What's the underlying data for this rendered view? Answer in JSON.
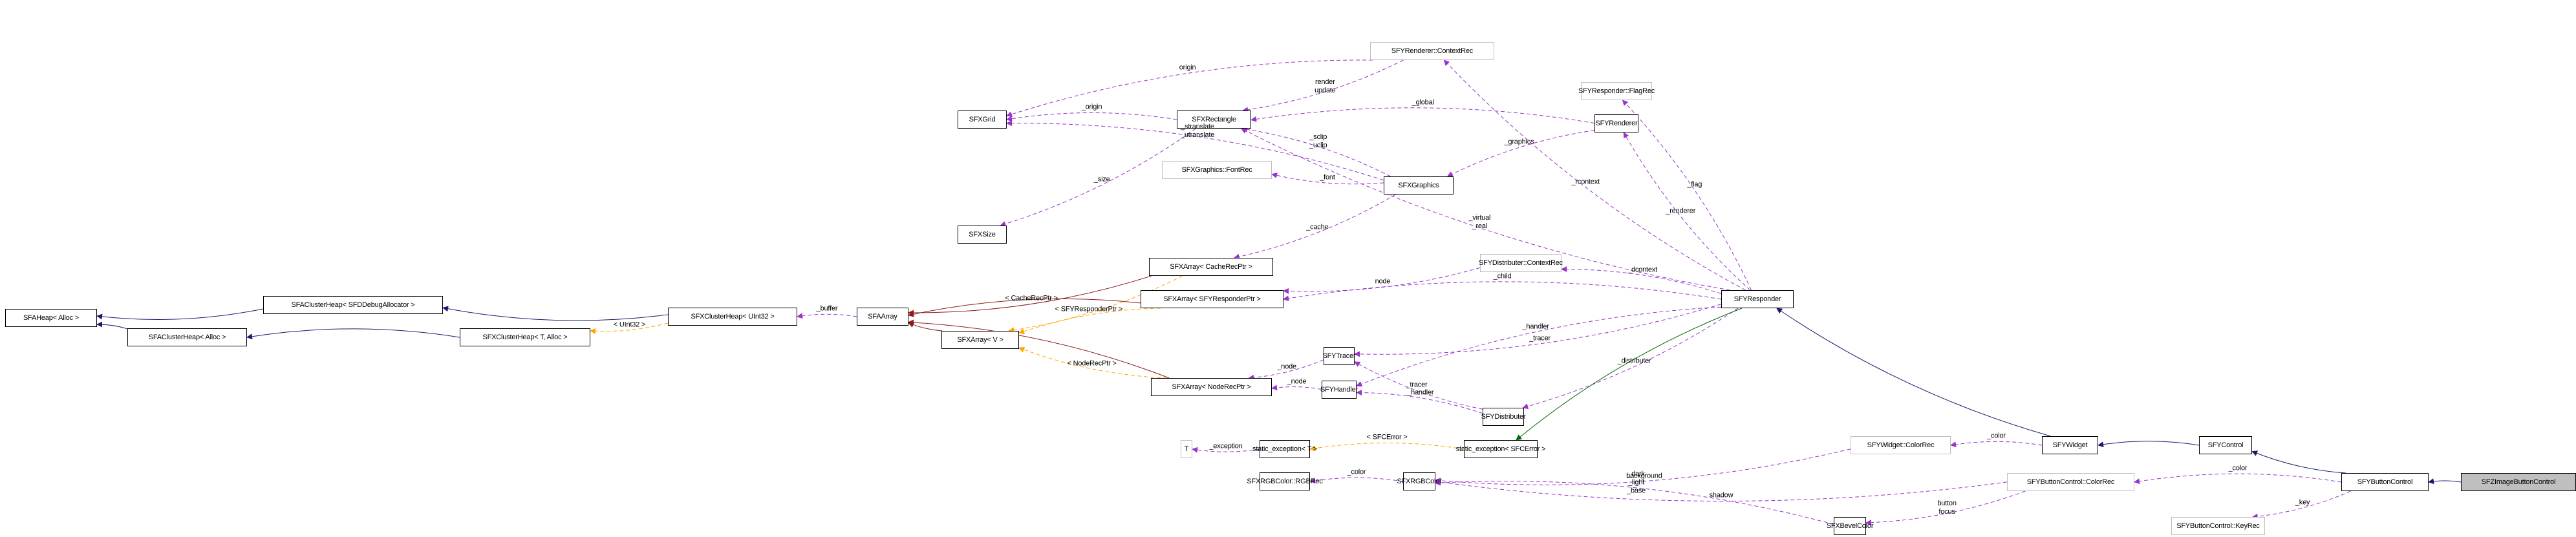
{
  "diagram": {
    "type": "collaboration-graph",
    "focus_class": "SFZImageButtonControl",
    "legend_colors": {
      "public_inheritance": "#191970",
      "protected_inheritance": "#006400",
      "private_inheritance": "#8b1a1a",
      "usage": "#9a32cd",
      "template_instance": "#ffa500"
    },
    "nodes": [
      {
        "id": "SFAHeap",
        "label": "SFAHeap< Alloc >",
        "style": "normal"
      },
      {
        "id": "SFAClusterHeapDbg",
        "label": "SFAClusterHeap< SFDDebugAllocator >",
        "style": "normal"
      },
      {
        "id": "SFAClusterHeap",
        "label": "SFAClusterHeap< Alloc >",
        "style": "normal"
      },
      {
        "id": "SFXClusterHeapU32",
        "label": "SFXClusterHeap< UInt32 >",
        "style": "normal"
      },
      {
        "id": "SFXClusterHeapT",
        "label": "SFXClusterHeap< T, Alloc >",
        "style": "normal"
      },
      {
        "id": "SFAArray",
        "label": "SFAArray",
        "style": "normal"
      },
      {
        "id": "SFXArrayCache",
        "label": "SFXArray< CacheRecPtr >",
        "style": "normal"
      },
      {
        "id": "SFXArrayResp",
        "label": "SFXArray< SFYResponderPtr >",
        "style": "normal"
      },
      {
        "id": "SFXArrayV",
        "label": "SFXArray< V >",
        "style": "normal"
      },
      {
        "id": "SFXArrayNode",
        "label": "SFXArray< NodeRecPtr >",
        "style": "normal"
      },
      {
        "id": "SFXGrid",
        "label": "SFXGrid",
        "style": "normal"
      },
      {
        "id": "SFXRectangle",
        "label": "SFXRectangle",
        "style": "normal"
      },
      {
        "id": "SFXSize",
        "label": "SFXSize",
        "style": "normal"
      },
      {
        "id": "FontRec",
        "label": "SFXGraphics::FontRec",
        "style": "gray"
      },
      {
        "id": "SFXGraphics",
        "label": "SFXGraphics",
        "style": "normal"
      },
      {
        "id": "RendererContextRec",
        "label": "SFYRenderer::ContextRec",
        "style": "gray"
      },
      {
        "id": "FlagRec",
        "label": "SFYResponder::FlagRec",
        "style": "gray"
      },
      {
        "id": "SFYRenderer",
        "label": "SFYRenderer",
        "style": "normal"
      },
      {
        "id": "DistContextRec",
        "label": "SFYDistributer::ContextRec",
        "style": "gray"
      },
      {
        "id": "SFYResponder",
        "label": "SFYResponder",
        "style": "normal"
      },
      {
        "id": "SFYTracer",
        "label": "SFYTracer",
        "style": "normal"
      },
      {
        "id": "SFYHandler",
        "label": "SFYHandler",
        "style": "normal"
      },
      {
        "id": "SFYDistributer",
        "label": "SFYDistributer",
        "style": "normal"
      },
      {
        "id": "T",
        "label": "T",
        "style": "gray"
      },
      {
        "id": "StaticExcT",
        "label": "static_exception< T >",
        "style": "normal"
      },
      {
        "id": "StaticExcErr",
        "label": "static_exception< SFCError >",
        "style": "normal"
      },
      {
        "id": "RGBRec",
        "label": "SFXRGBColor::RGBRec",
        "style": "normal"
      },
      {
        "id": "SFXRGBColor",
        "label": "SFXRGBColor",
        "style": "normal"
      },
      {
        "id": "SFXBevelColor",
        "label": "SFXBevelColor",
        "style": "normal"
      },
      {
        "id": "WidgetColorRec",
        "label": "SFYWidget::ColorRec",
        "style": "gray"
      },
      {
        "id": "SFYWidget",
        "label": "SFYWidget",
        "style": "normal"
      },
      {
        "id": "SFYControl",
        "label": "SFYControl",
        "style": "normal"
      },
      {
        "id": "BtnColorRec",
        "label": "SFYButtonControl::ColorRec",
        "style": "gray"
      },
      {
        "id": "SFYButtonControl",
        "label": "SFYButtonControl",
        "style": "normal"
      },
      {
        "id": "SFZImageButtonControl",
        "label": "SFZImageButtonControl",
        "style": "focus"
      },
      {
        "id": "KeyRec",
        "label": "SFYButtonControl::KeyRec",
        "style": "gray"
      }
    ],
    "edges": [
      {
        "from": "SFAClusterHeapDbg",
        "to": "SFAHeap",
        "kind": "public_inheritance",
        "label": ""
      },
      {
        "from": "SFAClusterHeap",
        "to": "SFAHeap",
        "kind": "public_inheritance",
        "label": ""
      },
      {
        "from": "SFXClusterHeapU32",
        "to": "SFAClusterHeapDbg",
        "kind": "public_inheritance",
        "label": ""
      },
      {
        "from": "SFXClusterHeapT",
        "to": "SFAClusterHeap",
        "kind": "public_inheritance",
        "label": ""
      },
      {
        "from": "SFXClusterHeapU32",
        "to": "SFXClusterHeapT",
        "kind": "template_instance",
        "label": "< UInt32 >"
      },
      {
        "from": "SFAArray",
        "to": "SFXClusterHeapU32",
        "kind": "usage",
        "label": "_buffer"
      },
      {
        "from": "SFXArrayCache",
        "to": "SFAArray",
        "kind": "private_inheritance",
        "label": "< CacheRecPtr >"
      },
      {
        "from": "SFXArrayResp",
        "to": "SFAArray",
        "kind": "private_inheritance",
        "label": ""
      },
      {
        "from": "SFXArrayV",
        "to": "SFAArray",
        "kind": "private_inheritance",
        "label": ""
      },
      {
        "from": "SFXArrayNode",
        "to": "SFAArray",
        "kind": "private_inheritance",
        "label": ""
      },
      {
        "from": "SFXArrayCache",
        "to": "SFXArrayV",
        "kind": "template_instance",
        "label": ""
      },
      {
        "from": "SFXArrayResp",
        "to": "SFXArrayV",
        "kind": "template_instance",
        "label": "< SFYResponderPtr >"
      },
      {
        "from": "SFXArrayNode",
        "to": "SFXArrayV",
        "kind": "template_instance",
        "label": "< NodeRecPtr >"
      },
      {
        "from": "RendererContextRec",
        "to": "SFXGrid",
        "kind": "usage",
        "label": "origin"
      },
      {
        "from": "RendererContextRec",
        "to": "SFXRectangle",
        "kind": "usage",
        "label": "render\nupdate"
      },
      {
        "from": "SFXRectangle",
        "to": "SFXGrid",
        "kind": "usage",
        "label": "_origin"
      },
      {
        "from": "SFXRectangle",
        "to": "SFXSize",
        "kind": "usage",
        "label": "_size"
      },
      {
        "from": "SFYRenderer",
        "to": "SFXRectangle",
        "kind": "usage",
        "label": "_global"
      },
      {
        "from": "SFYResponder",
        "to": "SFXRectangle",
        "kind": "usage",
        "label": "_virtual\n_real"
      },
      {
        "from": "SFXGraphics",
        "to": "SFXRectangle",
        "kind": "usage",
        "label": "_sclip\n_uclip"
      },
      {
        "from": "SFXGraphics",
        "to": "FontRec",
        "kind": "usage",
        "label": "_font"
      },
      {
        "from": "SFXGraphics",
        "to": "SFXGrid",
        "kind": "usage",
        "label": "_stranslate\n_utranslate"
      },
      {
        "from": "SFXGraphics",
        "to": "SFXArrayCache",
        "kind": "usage",
        "label": "_cache"
      },
      {
        "from": "SFYRenderer",
        "to": "SFXGraphics",
        "kind": "usage",
        "label": "_graphics"
      },
      {
        "from": "SFYResponder",
        "to": "RendererContextRec",
        "kind": "usage",
        "label": "_rcontext"
      },
      {
        "from": "SFYResponder",
        "to": "FlagRec",
        "kind": "usage",
        "label": "_flag"
      },
      {
        "from": "SFYResponder",
        "to": "SFYRenderer",
        "kind": "usage",
        "label": "_renderer"
      },
      {
        "from": "SFYResponder",
        "to": "DistContextRec",
        "kind": "usage",
        "label": "_dcontext"
      },
      {
        "from": "DistContextRec",
        "to": "SFXArrayResp",
        "kind": "usage",
        "label": "node"
      },
      {
        "from": "SFYResponder",
        "to": "SFXArrayResp",
        "kind": "usage",
        "label": "_child"
      },
      {
        "from": "SFYResponder",
        "to": "SFYTracer",
        "kind": "usage",
        "label": "_tracer"
      },
      {
        "from": "SFYResponder",
        "to": "SFYHandler",
        "kind": "usage",
        "label": "_handler"
      },
      {
        "from": "SFYResponder",
        "to": "SFYDistributer",
        "kind": "usage",
        "label": "_distributer"
      },
      {
        "from": "SFYResponder",
        "to": "StaticExcErr",
        "kind": "protected_inheritance",
        "label": ""
      },
      {
        "from": "SFYTracer",
        "to": "SFXArrayNode",
        "kind": "usage",
        "label": "_node"
      },
      {
        "from": "SFYHandler",
        "to": "SFXArrayNode",
        "kind": "usage",
        "label": "_node"
      },
      {
        "from": "SFYDistributer",
        "to": "SFYTracer",
        "kind": "usage",
        "label": "_tracer"
      },
      {
        "from": "SFYDistributer",
        "to": "SFYHandler",
        "kind": "usage",
        "label": "_handler"
      },
      {
        "from": "StaticExcT",
        "to": "T",
        "kind": "usage",
        "label": "_exception"
      },
      {
        "from": "StaticExcErr",
        "to": "StaticExcT",
        "kind": "template_instance",
        "label": "< SFCError >"
      },
      {
        "from": "WidgetColorRec",
        "to": "SFXRGBColor",
        "kind": "usage",
        "label": "background"
      },
      {
        "from": "SFXRGBColor",
        "to": "RGBRec",
        "kind": "usage",
        "label": "_color"
      },
      {
        "from": "BtnColorRec",
        "to": "SFXRGBColor",
        "kind": "usage",
        "label": "shadow"
      },
      {
        "from": "SFXBevelColor",
        "to": "SFXRGBColor",
        "kind": "usage",
        "label": "_dark\n_light\n_base"
      },
      {
        "from": "BtnColorRec",
        "to": "SFXBevelColor",
        "kind": "usage",
        "label": "button\nfocus"
      },
      {
        "from": "SFYWidget",
        "to": "WidgetColorRec",
        "kind": "usage",
        "label": "_color"
      },
      {
        "from": "SFYWidget",
        "to": "SFYResponder",
        "kind": "public_inheritance",
        "label": ""
      },
      {
        "from": "SFYControl",
        "to": "SFYWidget",
        "kind": "public_inheritance",
        "label": ""
      },
      {
        "from": "SFYButtonControl",
        "to": "SFYControl",
        "kind": "public_inheritance",
        "label": ""
      },
      {
        "from": "SFYButtonControl",
        "to": "BtnColorRec",
        "kind": "usage",
        "label": "_color"
      },
      {
        "from": "SFYButtonControl",
        "to": "KeyRec",
        "kind": "usage",
        "label": "_key"
      },
      {
        "from": "SFZImageButtonControl",
        "to": "SFYButtonControl",
        "kind": "public_inheritance",
        "label": ""
      }
    ]
  }
}
